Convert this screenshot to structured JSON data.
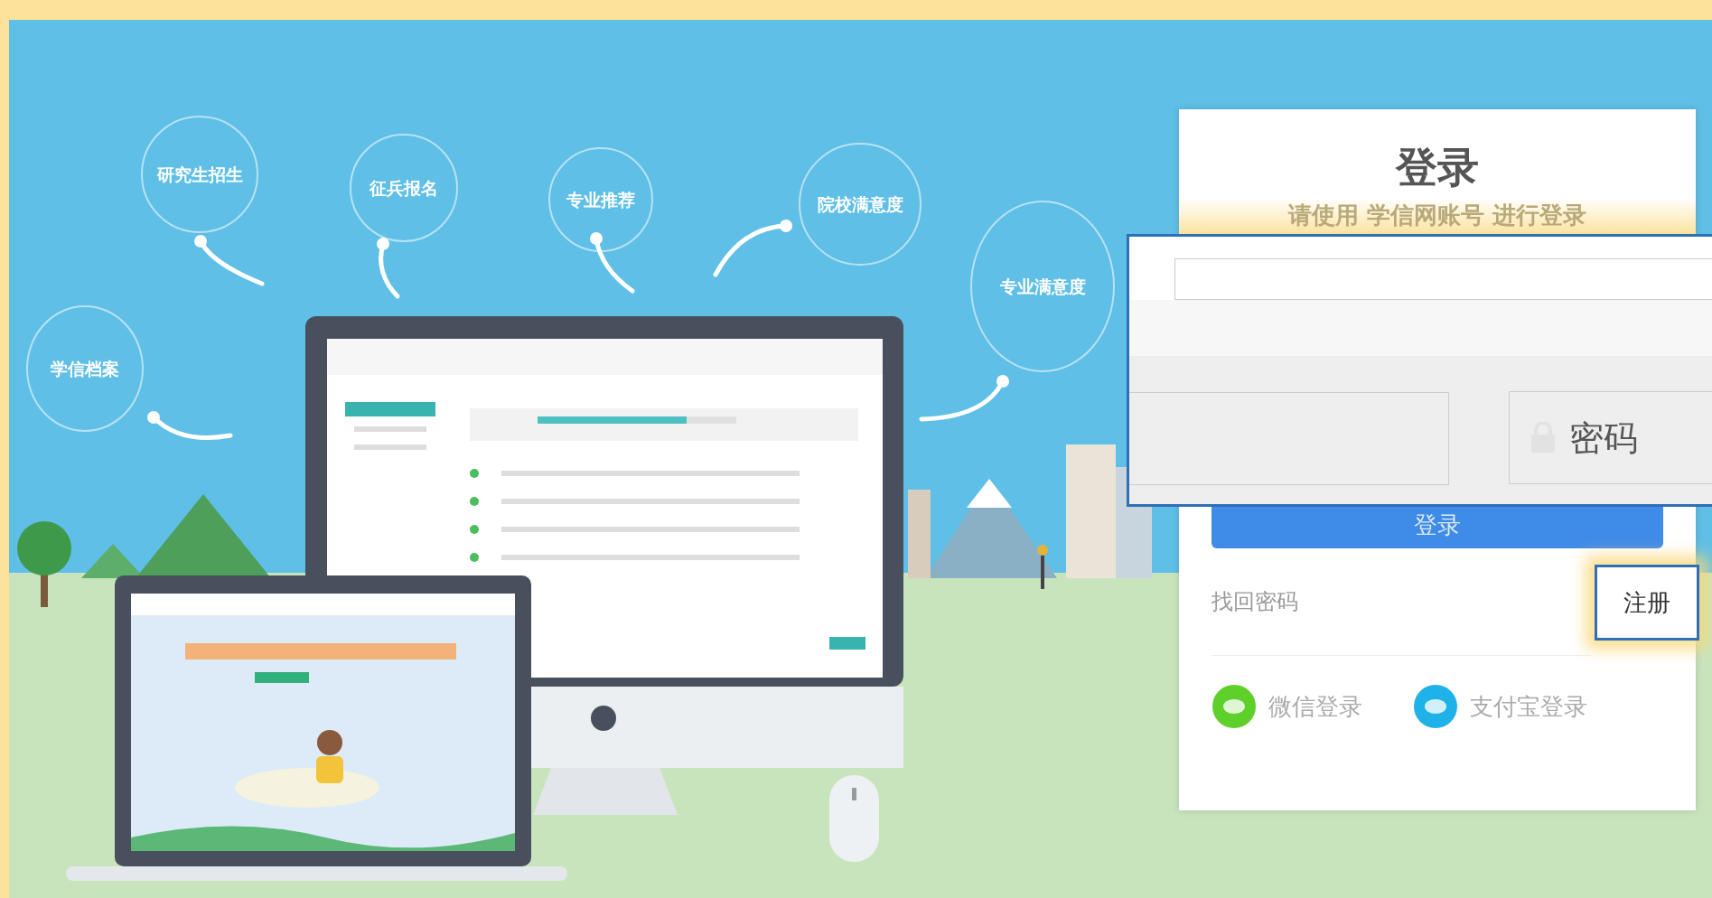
{
  "feature_bubbles": [
    {
      "label": "研究生招生"
    },
    {
      "label": "征兵报名"
    },
    {
      "label": "专业推荐"
    },
    {
      "label": "院校满意度"
    },
    {
      "label": "专业满意度"
    },
    {
      "label": "学信档案"
    }
  ],
  "login_card": {
    "title": "登录",
    "subtitle": "请使用 学信网账号 进行登录",
    "login_button": "登录",
    "forgot_password": "找回密码",
    "social_logins": [
      {
        "label": "微信登录",
        "kind": "wechat"
      },
      {
        "label": "支付宝登录",
        "kind": "alipay"
      }
    ]
  },
  "overlay_panel": {
    "password_field": {
      "placeholder": "密码"
    }
  },
  "register_button": "注册"
}
